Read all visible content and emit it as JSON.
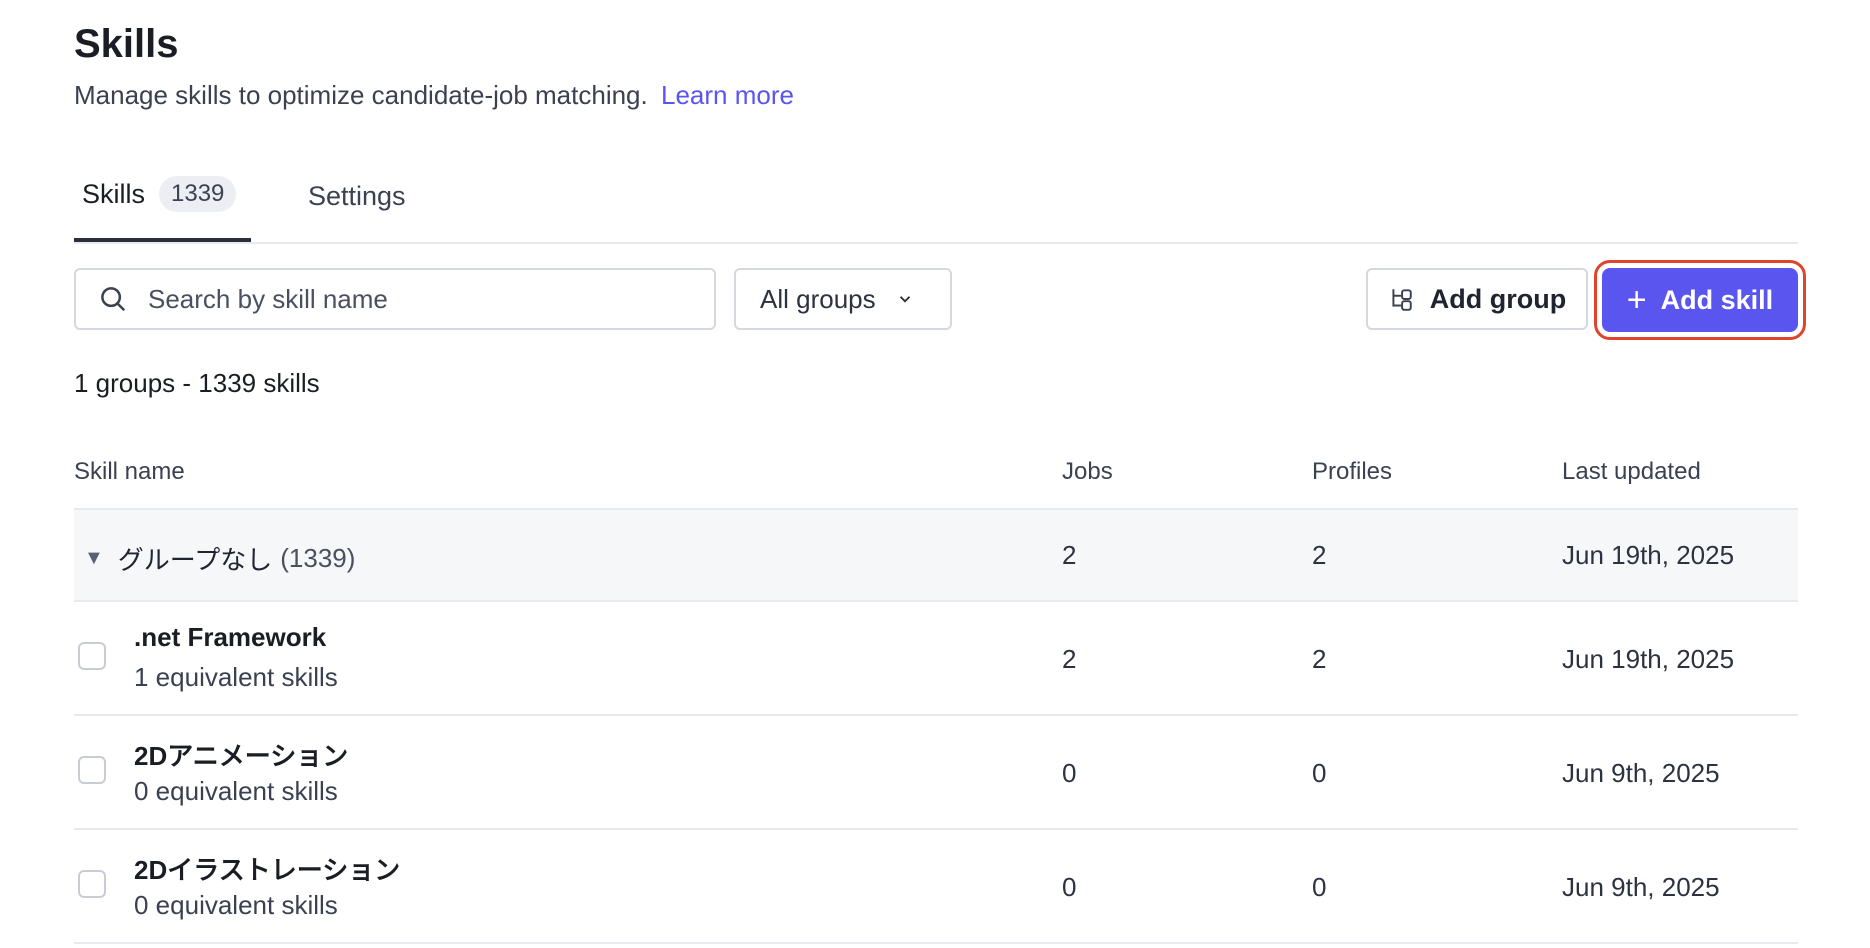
{
  "header": {
    "title": "Skills",
    "subtitle": "Manage skills to optimize candidate-job matching.",
    "learn_more": "Learn more"
  },
  "tabs": [
    {
      "label": "Skills",
      "count": "1339"
    },
    {
      "label": "Settings"
    }
  ],
  "toolbar": {
    "search_placeholder": "Search by skill name",
    "groups_filter": "All groups",
    "add_group": "Add group",
    "add_skill": "Add skill"
  },
  "summary": "1 groups - 1339 skills",
  "table": {
    "columns": [
      "Skill name",
      "Jobs",
      "Profiles",
      "Last updated"
    ],
    "group": {
      "name": "グループなし",
      "count": "(1339)",
      "jobs": "2",
      "profiles": "2",
      "updated": "Jun 19th, 2025"
    },
    "rows": [
      {
        "name": ".net Framework",
        "equiv": "1 equivalent skills",
        "jobs": "2",
        "profiles": "2",
        "updated": "Jun 19th, 2025"
      },
      {
        "name": "2Dアニメーション",
        "equiv": "0 equivalent skills",
        "jobs": "0",
        "profiles": "0",
        "updated": "Jun 9th, 2025"
      },
      {
        "name": "2Dイラストレーション",
        "equiv": "0 equivalent skills",
        "jobs": "0",
        "profiles": "0",
        "updated": "Jun 9th, 2025"
      }
    ]
  },
  "colors": {
    "accent": "#5b55f0",
    "highlight_ring": "#e0442d"
  }
}
